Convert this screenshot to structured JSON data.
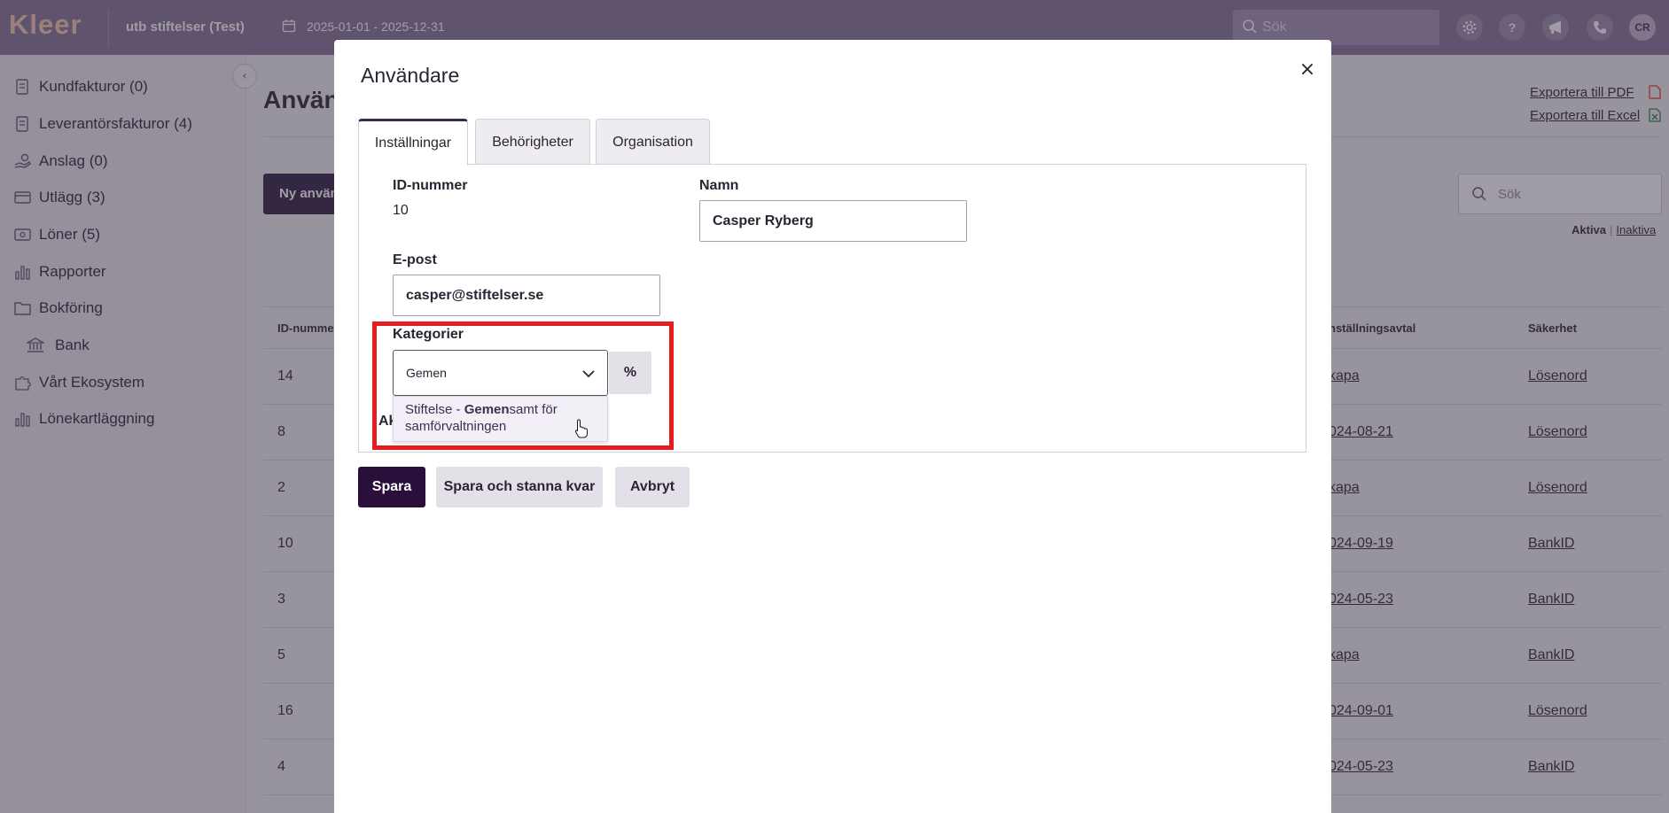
{
  "topbar": {
    "logo": "Kleer",
    "company": "utb stiftelser (Test)",
    "period": "2025-01-01 - 2025-12-31",
    "search_placeholder": "Sök",
    "avatar_initials": "CR",
    "icons": [
      "gear-icon",
      "help-icon",
      "megaphone-icon",
      "phone-icon"
    ]
  },
  "sidebar": {
    "items": [
      {
        "label": "Kundfakturor  (0)",
        "icon": "invoice-icon"
      },
      {
        "label": "Leverantörsfakturor  (4)",
        "icon": "invoice-icon"
      },
      {
        "label": "Anslag  (0)",
        "icon": "hand-coin-icon"
      },
      {
        "label": "Utlägg  (3)",
        "icon": "card-icon"
      },
      {
        "label": "Löner  (5)",
        "icon": "cash-icon"
      },
      {
        "label": "Rapporter",
        "icon": "bar-chart-icon"
      },
      {
        "label": "Bokföring",
        "icon": "folder-icon"
      },
      {
        "label": "Bank",
        "icon": "bank-icon"
      },
      {
        "label": "Vårt Ekosystem",
        "icon": "puzzle-icon"
      },
      {
        "label": "Lönekartläggning",
        "icon": "bar-chart-icon"
      }
    ]
  },
  "main": {
    "title": "Använd",
    "new_button": "Ny använ",
    "export_pdf": "Exportera till PDF",
    "export_excel": "Exportera till Excel",
    "search_placeholder": "Sök",
    "filter_active": "Aktiva",
    "filter_inactive": "Inaktiva",
    "columns": {
      "id": "ID-numme",
      "agreement": "nställningsavtal",
      "security": "Säkerhet"
    },
    "rows": [
      {
        "id": "14",
        "agreement": "kapa",
        "security": "Lösenord"
      },
      {
        "id": "8",
        "agreement": "024-08-21",
        "security": "Lösenord"
      },
      {
        "id": "2",
        "agreement": "kapa",
        "security": "Lösenord"
      },
      {
        "id": "10",
        "agreement": "024-09-19",
        "security": "BankID"
      },
      {
        "id": "3",
        "agreement": "024-05-23",
        "security": "BankID"
      },
      {
        "id": "5",
        "agreement": "kapa",
        "security": "BankID"
      },
      {
        "id": "16",
        "agreement": "024-09-01",
        "security": "Lösenord"
      },
      {
        "id": "4",
        "agreement": "024-05-23",
        "security": "BankID"
      }
    ]
  },
  "modal": {
    "title": "Användare",
    "tabs": [
      "Inställningar",
      "Behörigheter",
      "Organisation"
    ],
    "active_tab": "Inställningar",
    "id_label": "ID-nummer",
    "id_value": "10",
    "name_label": "Namn",
    "name_value": "Casper Ryberg",
    "email_label": "E-post",
    "email_value": "casper@stiftelser.se",
    "categories_label": "Kategorier",
    "category_value": "Gemen",
    "percent_button": "%",
    "dropdown_option": {
      "prefix": "Stiftelse - ",
      "match": "Gemen",
      "suffix": "samt för",
      "line2": "samförvaltningen"
    },
    "hidden_label_fragment": "Ak",
    "buttons": {
      "save": "Spara",
      "save_stay": "Spara och stanna kvar",
      "cancel": "Avbryt"
    }
  },
  "colors": {
    "topbar": "#8a7b9c",
    "primary_button": "#2a0f3a",
    "highlight": "#e41e1e"
  }
}
